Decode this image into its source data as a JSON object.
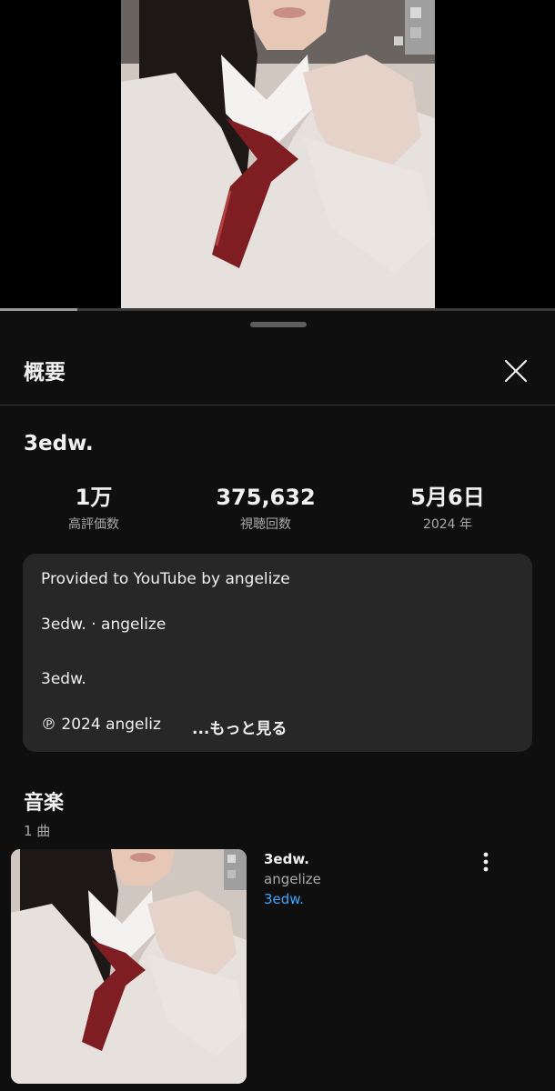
{
  "player": {
    "progress_fraction": 0.14
  },
  "sheet": {
    "title": "概要"
  },
  "video": {
    "title": "3edw."
  },
  "stats": [
    {
      "value": "1万",
      "label": "高評価数"
    },
    {
      "value": "375,632",
      "label": "視聴回数"
    },
    {
      "value": "5月6日",
      "label": "2024 年"
    }
  ],
  "description": {
    "line1": "Provided to YouTube by angelize",
    "line2": "3edw. · angelize",
    "line3": "3edw.",
    "line4": "℗ 2024 angeliz",
    "more": "...もっと見る"
  },
  "music": {
    "title": "音楽",
    "count": "1 曲",
    "track": {
      "title": "3edw.",
      "artist": "angelize",
      "album": "3edw."
    }
  },
  "icons": {
    "close": "close-icon",
    "more": "more-vert-icon"
  },
  "colors": {
    "link": "#3ea6ff",
    "background": "#0f0f0f",
    "card": "#272727"
  }
}
